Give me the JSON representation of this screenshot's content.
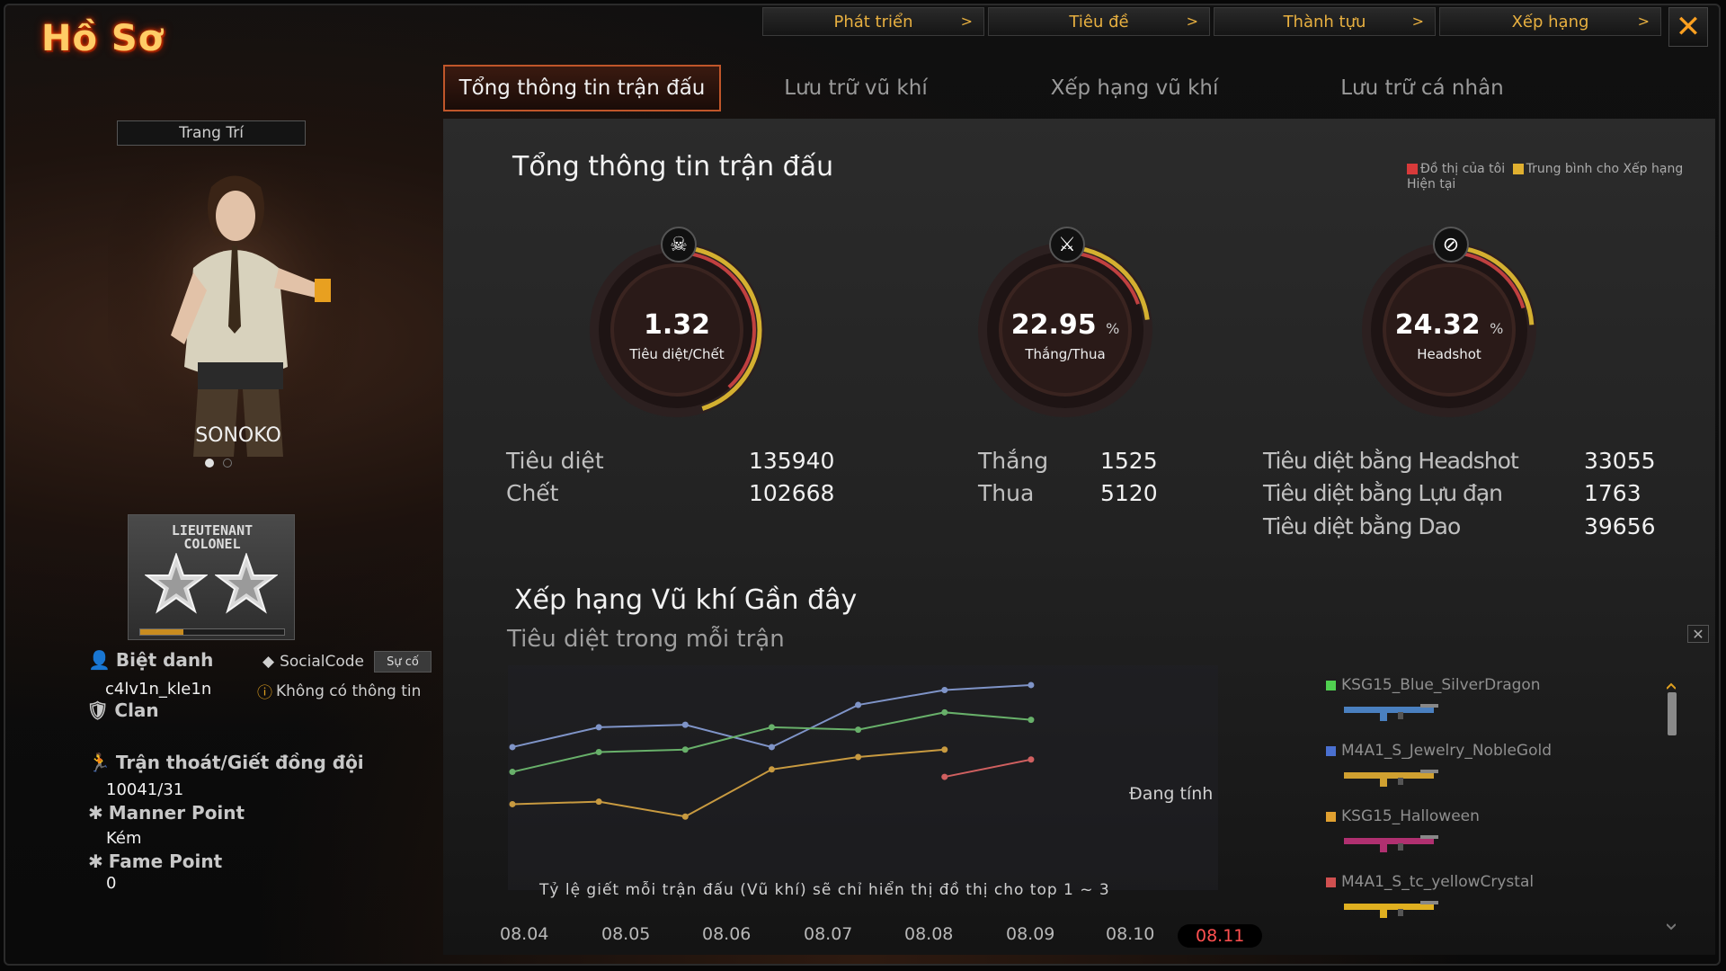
{
  "app": {
    "title": "Hồ Sơ"
  },
  "top_menu": [
    {
      "label": "Phát triển"
    },
    {
      "label": "Tiêu đề"
    },
    {
      "label": "Thành tựu"
    },
    {
      "label": "Xếp hạng"
    }
  ],
  "tabs": [
    {
      "label": "Tổng thông tin trận đấu",
      "active": true
    },
    {
      "label": "Lưu trữ vũ khí"
    },
    {
      "label": "Xếp hạng vũ khí"
    },
    {
      "label": "Lưu trữ cá nhân"
    }
  ],
  "profile": {
    "decor_button": "Trang Trí",
    "character_name": "SONOKO",
    "rank_line1": "LIEUTENANT",
    "rank_line2": "COLONEL",
    "rank_progress": 0.3,
    "nickname_label": "Biệt danh",
    "nickname": "c4lv1n_kle1n",
    "socialcode_label": "SocialCode",
    "socialcode_button": "Sự cố",
    "socialcode_value": "Không có thông tin",
    "clan_label": "Clan",
    "escape_label": "Trận thoát/Giết đồng đội",
    "escape_value": "10041/31",
    "manner_label": "Manner Point",
    "manner_value": "Kém",
    "fame_label": "Fame Point",
    "fame_value": "0"
  },
  "summary": {
    "title": "Tổng thông tin trận đấu",
    "legend_mine": "Đồ thị của tôi",
    "legend_avg": "Trung bình cho Xếp hạng Hiện tại",
    "colors": {
      "mine": "#d83a3a",
      "avg": "#e0b030"
    },
    "gauges": [
      {
        "value": "1.32",
        "unit": "",
        "label": "Tiêu diệt/Chết",
        "icon": "skull-icon",
        "fill": 0.45
      },
      {
        "value": "22.95",
        "unit": "%",
        "label": "Thắng/Thua",
        "icon": "crossed-guns-icon",
        "fill": 0.23
      },
      {
        "value": "24.32",
        "unit": "%",
        "label": "Headshot",
        "icon": "headshot-icon",
        "fill": 0.24
      }
    ],
    "stats": {
      "kills_label": "Tiêu diệt",
      "kills": "135940",
      "deaths_label": "Chết",
      "deaths": "102668",
      "wins_label": "Thắng",
      "wins": "1525",
      "losses_label": "Thua",
      "losses": "5120",
      "hs_label": "Tiêu diệt bằng Headshot",
      "hs": "33055",
      "grenade_label": "Tiêu diệt bằng Lựu đạn",
      "grenade": "1763",
      "knife_label": "Tiêu diệt bằng Dao",
      "knife": "39656"
    }
  },
  "recent": {
    "title": "Xếp hạng Vũ khí Gần đây",
    "subtitle": "Tiêu diệt trong mỗi trận",
    "note": "Tỷ lệ giết mỗi trận đấu (Vũ khí) sẽ chỉ hiển thị đồ thị cho top 1 ~ 3",
    "calculating": "Đang tính"
  },
  "chart_data": {
    "type": "line",
    "x": [
      "08.04",
      "08.05",
      "08.06",
      "08.07",
      "08.08",
      "08.09",
      "08.10",
      "08.11"
    ],
    "active_x": "08.11",
    "ylim": [
      0,
      10
    ],
    "series": [
      {
        "name": "KSG15_Blue_SilverDragon",
        "color": "#7f94c8",
        "values": [
          5.4,
          6.2,
          6.3,
          5.4,
          7.1,
          7.7,
          7.9,
          null
        ]
      },
      {
        "name": "M4A1_S_Jewelry_NobleGold",
        "color": "#68b06a",
        "values": [
          4.4,
          5.2,
          5.3,
          6.2,
          6.1,
          6.8,
          6.5,
          null
        ]
      },
      {
        "name": "KSG15_Halloween",
        "color": "#c89a40",
        "values": [
          3.1,
          3.2,
          2.6,
          4.5,
          5.0,
          5.3,
          null,
          null
        ]
      },
      {
        "name": "M4A1_S_tc_yellowCrystal",
        "color": "#d06060",
        "values": [
          null,
          null,
          null,
          null,
          null,
          4.2,
          4.9,
          null
        ]
      }
    ]
  },
  "weapons": [
    {
      "name": "KSG15_Blue_SilverDragon",
      "color": "#50d050",
      "gun": "#4a80c0"
    },
    {
      "name": "M4A1_S_Jewelry_NobleGold",
      "color": "#4a70d0",
      "gun": "#d0a030"
    },
    {
      "name": "KSG15_Halloween",
      "color": "#e0a030",
      "gun": "#b03070"
    },
    {
      "name": "M4A1_S_tc_yellowCrystal",
      "color": "#d05050",
      "gun": "#e0b020"
    }
  ]
}
